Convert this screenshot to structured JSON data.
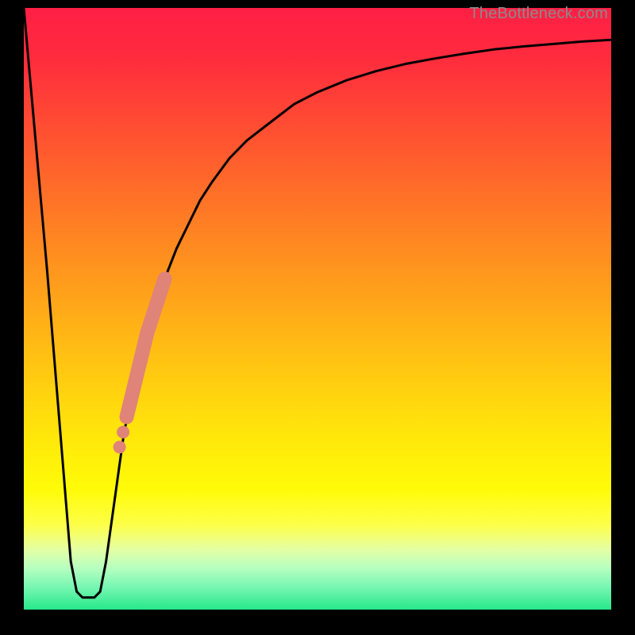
{
  "watermark": "TheBottleneck.com",
  "chart_data": {
    "type": "line",
    "title": "",
    "xlabel": "",
    "ylabel": "",
    "xlim": [
      0,
      100
    ],
    "ylim": [
      0,
      100
    ],
    "grid": false,
    "legend": false,
    "series": [
      {
        "name": "bottleneck-curve",
        "x": [
          0,
          2,
          4,
          5,
          6,
          7,
          8,
          9,
          10,
          11,
          12,
          13,
          14,
          15,
          16,
          17,
          18,
          19,
          20,
          22,
          24,
          26,
          28,
          30,
          32,
          35,
          38,
          42,
          46,
          50,
          55,
          60,
          65,
          70,
          75,
          80,
          85,
          90,
          95,
          100
        ],
        "y": [
          100,
          78,
          56,
          44,
          32,
          20,
          8,
          3,
          2,
          2,
          2,
          3,
          8,
          15,
          22,
          29,
          34,
          38,
          42,
          49,
          55,
          60,
          64,
          68,
          71,
          75,
          78,
          81,
          84,
          86,
          88,
          89.5,
          90.7,
          91.6,
          92.4,
          93.1,
          93.6,
          94.0,
          94.4,
          94.7
        ]
      }
    ],
    "markers": {
      "name": "highlight-segment",
      "color": "#e08378",
      "points": [
        {
          "x": 17.5,
          "y": 32.0
        },
        {
          "x": 18.0,
          "y": 34.0
        },
        {
          "x": 19.0,
          "y": 38.0
        },
        {
          "x": 20.0,
          "y": 42.0
        },
        {
          "x": 21.0,
          "y": 46.0
        },
        {
          "x": 22.0,
          "y": 49.0
        },
        {
          "x": 23.0,
          "y": 52.0
        },
        {
          "x": 24.0,
          "y": 55.0
        }
      ],
      "extra_dots": [
        {
          "x": 16.3,
          "y": 27.0
        },
        {
          "x": 16.9,
          "y": 29.5
        }
      ]
    },
    "gradient_stops": [
      {
        "pct": 0,
        "color": "#ff1f45"
      },
      {
        "pct": 50,
        "color": "#ffa31a"
      },
      {
        "pct": 80,
        "color": "#fffb08"
      },
      {
        "pct": 100,
        "color": "#27e88a"
      }
    ]
  }
}
